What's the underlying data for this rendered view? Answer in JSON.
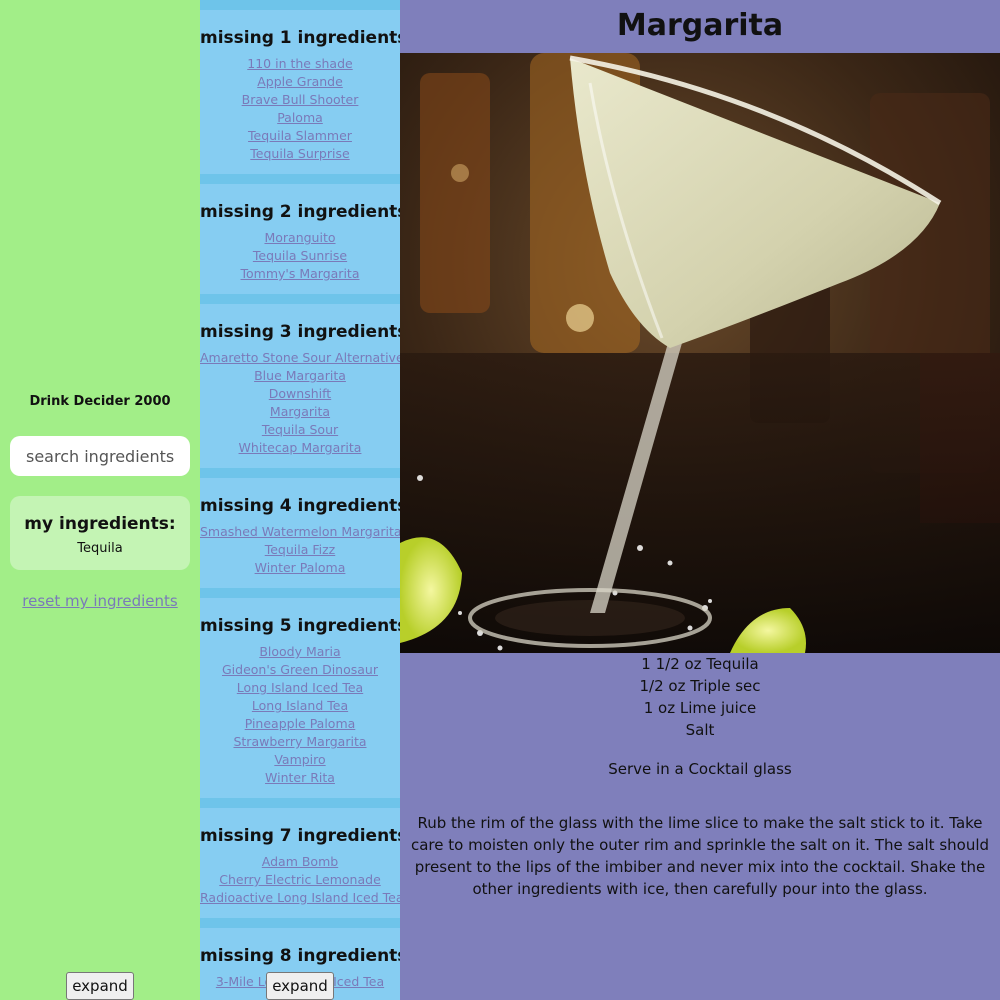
{
  "sidebar": {
    "title": "Drink Decider 2000",
    "search_placeholder": "search ingredients",
    "my_ingredients_title": "my ingredients:",
    "my_ingredients": [
      "Tequila"
    ],
    "reset_label": "reset my ingredients",
    "expand_label": "expand"
  },
  "groups": [
    {
      "title": "missing 1 ingredients",
      "drinks": [
        "110 in the shade",
        "Apple Grande",
        "Brave Bull Shooter",
        "Paloma",
        "Tequila Slammer",
        "Tequila Surprise"
      ]
    },
    {
      "title": "missing 2 ingredients",
      "drinks": [
        "Moranguito",
        "Tequila Sunrise",
        "Tommy's Margarita"
      ]
    },
    {
      "title": "missing 3 ingredients",
      "drinks": [
        "Amaretto Stone Sour Alternative",
        "Blue Margarita",
        "Downshift",
        "Margarita",
        "Tequila Sour",
        "Whitecap Margarita"
      ]
    },
    {
      "title": "missing 4 ingredients",
      "drinks": [
        "Smashed Watermelon Margarita",
        "Tequila Fizz",
        "Winter Paloma"
      ]
    },
    {
      "title": "missing 5 ingredients",
      "drinks": [
        "Bloody Maria",
        "Gideon's Green Dinosaur",
        "Long Island Iced Tea",
        "Long Island Tea",
        "Pineapple Paloma",
        "Strawberry Margarita",
        "Vampiro",
        "Winter Rita"
      ]
    },
    {
      "title": "missing 7 ingredients",
      "drinks": [
        "Adam Bomb",
        "Cherry Electric Lemonade",
        "Radioactive Long Island Iced Tea"
      ]
    },
    {
      "title": "missing 8 ingredients",
      "drinks": [
        "3-Mile Long Island Iced Tea"
      ]
    }
  ],
  "middle": {
    "expand_label": "expand"
  },
  "drink": {
    "name": "Margarita",
    "ingredients": [
      "1 1/2 oz Tequila",
      "1/2 oz Triple sec",
      "1 oz Lime juice",
      "Salt"
    ],
    "glass": "Serve in a Cocktail glass",
    "instructions": "Rub the rim of the glass with the lime slice to make the salt stick to it. Take care to moisten only the outer rim and sprinkle the salt on it. The salt should present to the lips of the imbiber and never mix into the cocktail. Shake the other ingredients with ice, then carefully pour into the glass."
  },
  "colors": {
    "sidebar_bg": "#a2ee88",
    "middle_bg": "#86cdf2",
    "right_bg": "#7f7fbb",
    "link": "#7a7ab9"
  }
}
